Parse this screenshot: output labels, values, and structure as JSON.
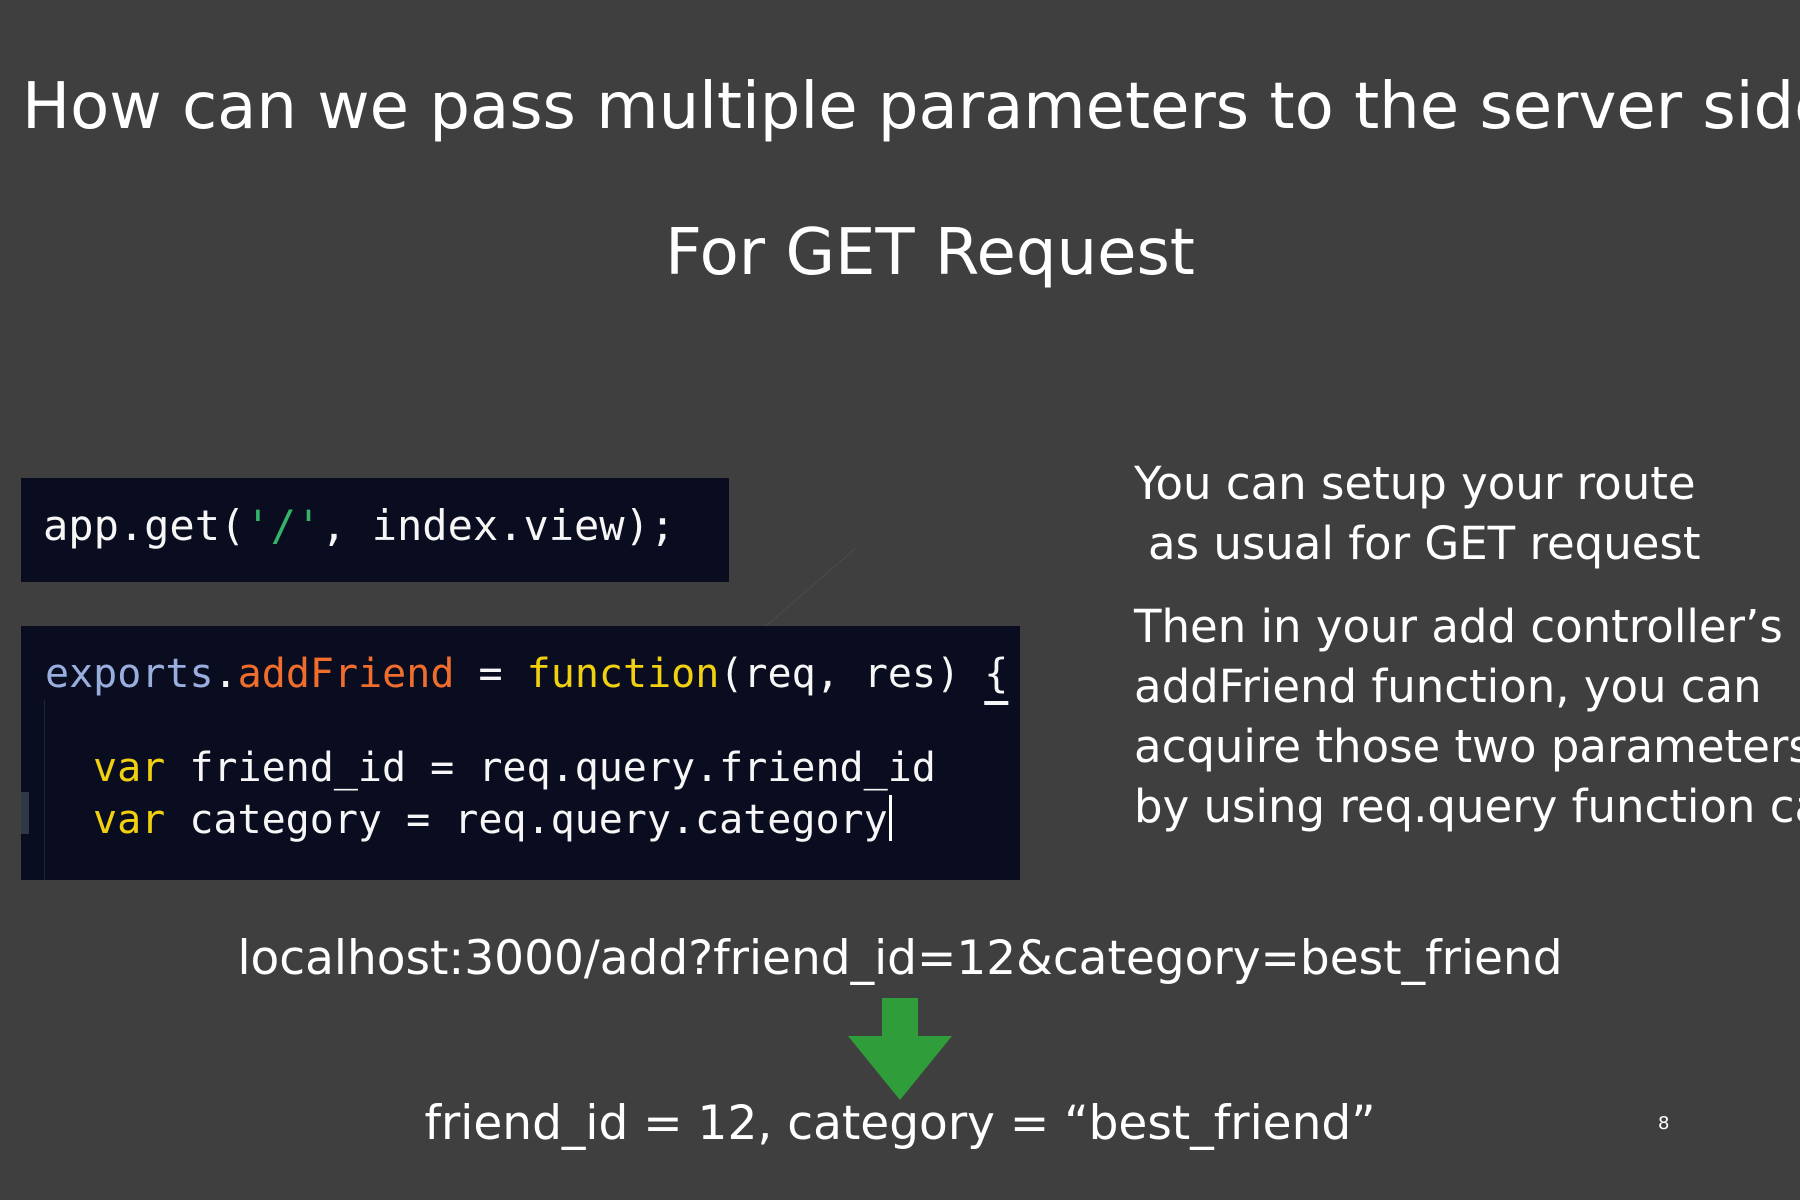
{
  "slide": {
    "title": "How can we pass multiple parameters to the server side?",
    "subtitle": "For GET Request",
    "page_number": "8"
  },
  "code_route": {
    "part1": "app.get(",
    "part2": "'/'",
    "part3": ", index.view);"
  },
  "code_controller": {
    "line1": {
      "obj": "exports",
      "dot": ".",
      "prop": "addFriend",
      "eq": " = ",
      "kw": "function",
      "args": "(req, res) ",
      "brace": "{"
    },
    "line2": {
      "kw": "var",
      "rest": " friend_id = req.query.friend_id"
    },
    "line3": {
      "kw": "var",
      "rest": " category = req.query.category"
    }
  },
  "description": {
    "paragraph1": [
      "You can setup your route",
      "as usual for GET request"
    ],
    "paragraph2": [
      "Then in your add controller’s",
      "addFriend function, you can",
      "acquire those two parameters",
      "by using req.query function call"
    ]
  },
  "url_example": "localhost:3000/add?friend_id=12&category=best_friend",
  "result_example": "friend_id = 12, category = “best_friend”",
  "colors": {
    "background": "#3f3f3f",
    "code_background": "#0a0d1f",
    "string": "#33b46a",
    "object": "#99aede",
    "property": "#f06d2d",
    "keyword": "#f1d10f",
    "arrow": "#2f9d3a"
  },
  "icons": {
    "arrow": "arrow-down-icon"
  }
}
